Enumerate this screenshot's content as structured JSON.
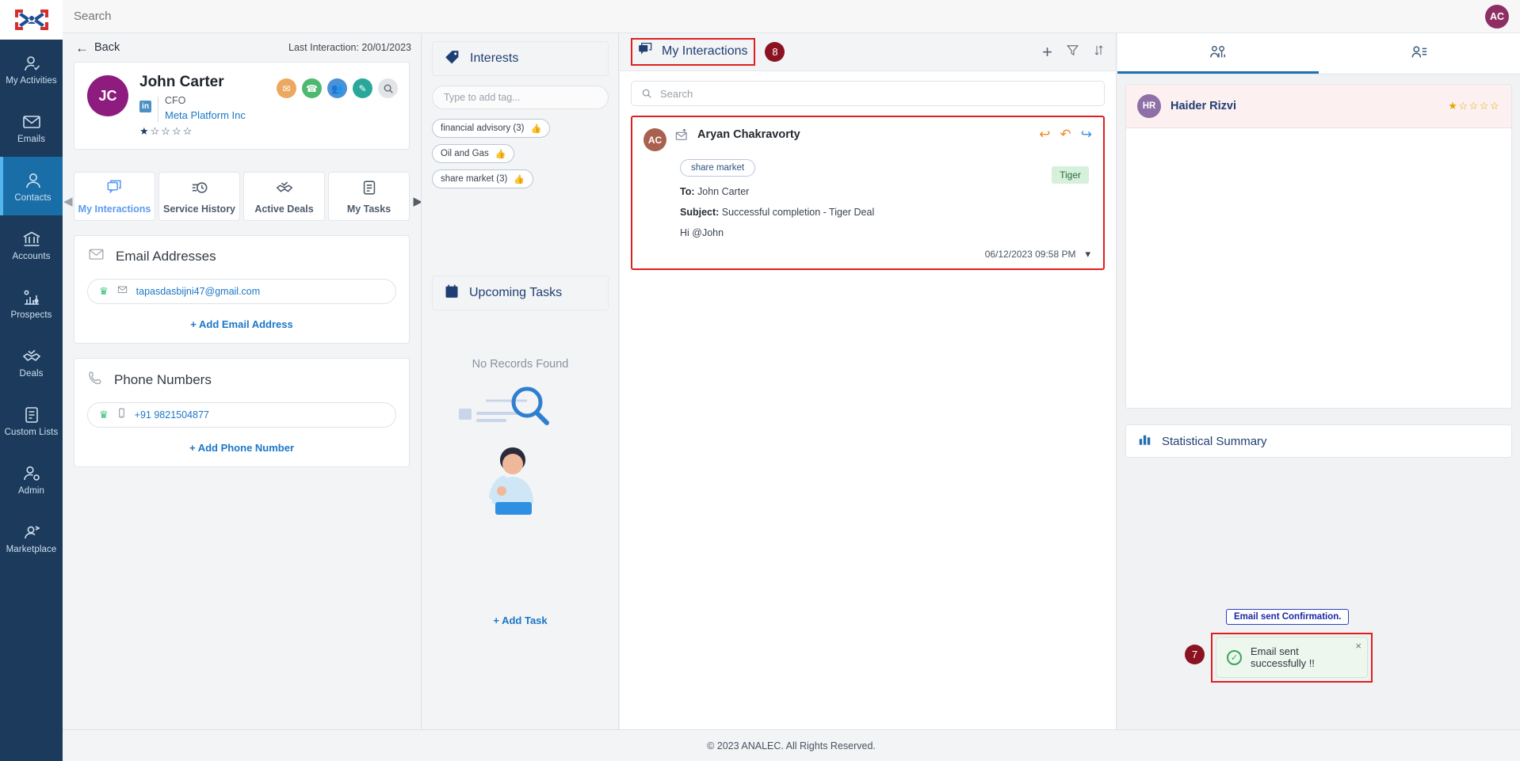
{
  "topbar": {
    "search_placeholder": "Search",
    "avatar_initials": "AC"
  },
  "sidebar": {
    "logo_name": "analec-logo",
    "items": [
      {
        "label": "My Activities",
        "icon": "user-check-icon",
        "active": false
      },
      {
        "label": "Emails",
        "icon": "envelope-icon",
        "active": false
      },
      {
        "label": "Contacts",
        "icon": "person-icon",
        "active": true
      },
      {
        "label": "Accounts",
        "icon": "bank-icon",
        "active": false
      },
      {
        "label": "Prospects",
        "icon": "chart-gear-icon",
        "active": false
      },
      {
        "label": "Deals",
        "icon": "handshake-check-icon",
        "active": false
      },
      {
        "label": "Custom Lists",
        "icon": "clipboard-list-icon",
        "active": false
      },
      {
        "label": "Admin",
        "icon": "user-gear-icon",
        "active": false
      },
      {
        "label": "Marketplace",
        "icon": "user-rocket-icon",
        "active": false
      }
    ]
  },
  "contact_panel": {
    "back_label": "Back",
    "last_interaction_label": "Last Interaction: 20/01/2023",
    "avatar_initials": "JC",
    "name": "John Carter",
    "linkedin_badge": "in",
    "job_title": "CFO",
    "company": "Meta Platform Inc",
    "rating": 1,
    "rating_max": 5,
    "action_icons": [
      {
        "name": "email-action-icon",
        "glyph": "✉",
        "color": "#eda860"
      },
      {
        "name": "phone-action-icon",
        "glyph": "☎",
        "color": "#4fb870"
      },
      {
        "name": "meeting-action-icon",
        "glyph": "👥",
        "color": "#4b91d6"
      },
      {
        "name": "note-action-icon",
        "glyph": "✎",
        "color": "#2aa79b"
      },
      {
        "name": "search-action-icon",
        "glyph": "🔍",
        "color": "#e2e4e8"
      }
    ],
    "tabs": [
      {
        "label": "My Interactions",
        "icon": "chat-stack-icon",
        "active": true
      },
      {
        "label": "Service History",
        "icon": "clock-history-icon",
        "active": false
      },
      {
        "label": "Active Deals",
        "icon": "handshake-check-icon",
        "active": false
      },
      {
        "label": "My Tasks",
        "icon": "clipboard-icon",
        "active": false
      }
    ],
    "email_section": {
      "title": "Email Addresses",
      "icon": "envelope-icon",
      "entries": [
        {
          "value": "tapasdasbijni47@gmail.com",
          "primary": true
        }
      ],
      "add_label": "+ Add Email Address"
    },
    "phone_section": {
      "title": "Phone Numbers",
      "icon": "phone-icon",
      "entries": [
        {
          "value": "+91 9821504877",
          "primary": true
        }
      ],
      "add_label": "+ Add Phone Number"
    }
  },
  "interests_panel": {
    "title": "Interests",
    "icon": "tag-icon",
    "tag_input_placeholder": "Type to add tag...",
    "tags": [
      {
        "label": "financial advisory (3)",
        "liked": false
      },
      {
        "label": "Oil and Gas",
        "liked": false
      },
      {
        "label": "share market (3)",
        "liked": true
      }
    ]
  },
  "tasks_panel": {
    "title": "Upcoming Tasks",
    "icon": "calendar-icon",
    "empty_text": "No Records Found",
    "empty_illustration": "person-searching-illustration",
    "add_label": "+ Add Task"
  },
  "interactions_panel": {
    "title": "My Interactions",
    "icon": "chat-stack-icon",
    "badge": "8",
    "tools": [
      {
        "name": "add-interaction-icon",
        "glyph": "+"
      },
      {
        "name": "filter-icon",
        "glyph": "filter"
      },
      {
        "name": "sort-icon",
        "glyph": "sort"
      }
    ],
    "search_placeholder": "Search",
    "messages": [
      {
        "avatar_initials": "AC",
        "sender": "Aryan Chakravorty",
        "channel_icon": "email-sent-icon",
        "tag": "share market",
        "to_label": "To:",
        "to_value": "John Carter",
        "subject_label": "Subject:",
        "subject_value": "Successful completion - Tiger Deal",
        "body": "Hi @John",
        "deal_chip": "Tiger",
        "date": "06/12/2023 09:58 PM",
        "actions": [
          {
            "name": "reply-icon",
            "glyph": "↩",
            "color": "orange"
          },
          {
            "name": "reply-all-icon",
            "glyph": "↭",
            "color": "orange"
          },
          {
            "name": "forward-icon",
            "glyph": "↪",
            "color": "blue"
          }
        ]
      }
    ]
  },
  "right_rail": {
    "tabs": [
      {
        "name": "relationship-tab",
        "icon": "people-chart-icon",
        "active": true
      },
      {
        "name": "contact-list-tab",
        "icon": "person-list-icon",
        "active": false
      }
    ],
    "people": [
      {
        "avatar_initials": "HR",
        "name": "Haider Rizvi",
        "rating": 1,
        "rating_max": 5
      }
    ],
    "statistical_summary": {
      "title": "Statistical Summary",
      "icon": "bar-chart-icon"
    }
  },
  "footer": {
    "text": "© 2023 ANALEC. All Rights Reserved."
  },
  "annotations": {
    "email_confirmation_label": "Email sent Confirmation.",
    "toast_badge": "7"
  },
  "toast": {
    "message": "Email sent successfully !!",
    "close_glyph": "×",
    "check_glyph": "✓"
  },
  "colors": {
    "sidebar_bg": "#1b3a5c",
    "sidebar_active": "#1a6ea8",
    "accent_blue": "#1b77c8",
    "highlight_red": "#e01f1f",
    "badge_dark_red": "#8b1220",
    "toast_green": "#3da35d"
  }
}
